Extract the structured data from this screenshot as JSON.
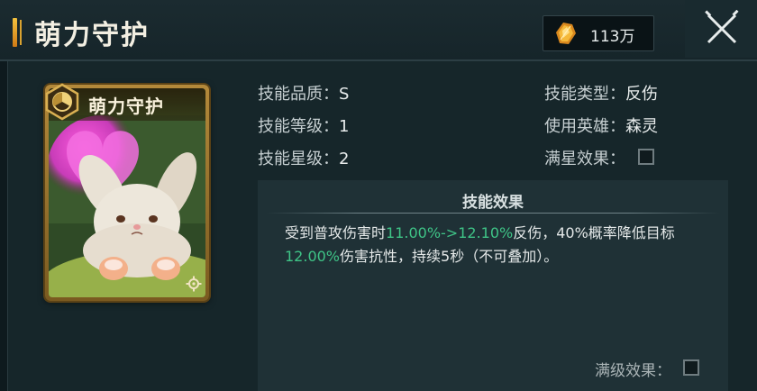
{
  "header": {
    "title": "萌力守护",
    "currency_value": "113万",
    "currency_icon": "gold-crystal-icon",
    "close_icon": "close-icon"
  },
  "card": {
    "name": "萌力守护",
    "emblem_icon": "triad-emblem-icon",
    "art": "bunny-portrait",
    "corner_icon": "gear-icon"
  },
  "info": {
    "quality_label": "技能品质：",
    "quality_value": "S",
    "level_label": "技能等级：",
    "level_value": "1",
    "star_label": "技能星级：",
    "star_value": "2",
    "type_label": "技能类型：",
    "type_value": "反伤",
    "hero_label": "使用英雄：",
    "hero_value": "森灵",
    "fullstar_label": "满星效果："
  },
  "effect": {
    "title": "技能效果",
    "text_1": "受到普攻伤害时",
    "highlight_1": "11.00%->12.10%",
    "text_2": "反伤，40%概率降低目标",
    "highlight_2": "12.00%",
    "text_3": "伤害抗性，持续5秒（不可叠加）。",
    "full_level_label": "满级效果："
  },
  "colors": {
    "highlight": "#3fc487",
    "accent_gold": "#f4c23e",
    "panel_bg": "#16262a"
  }
}
